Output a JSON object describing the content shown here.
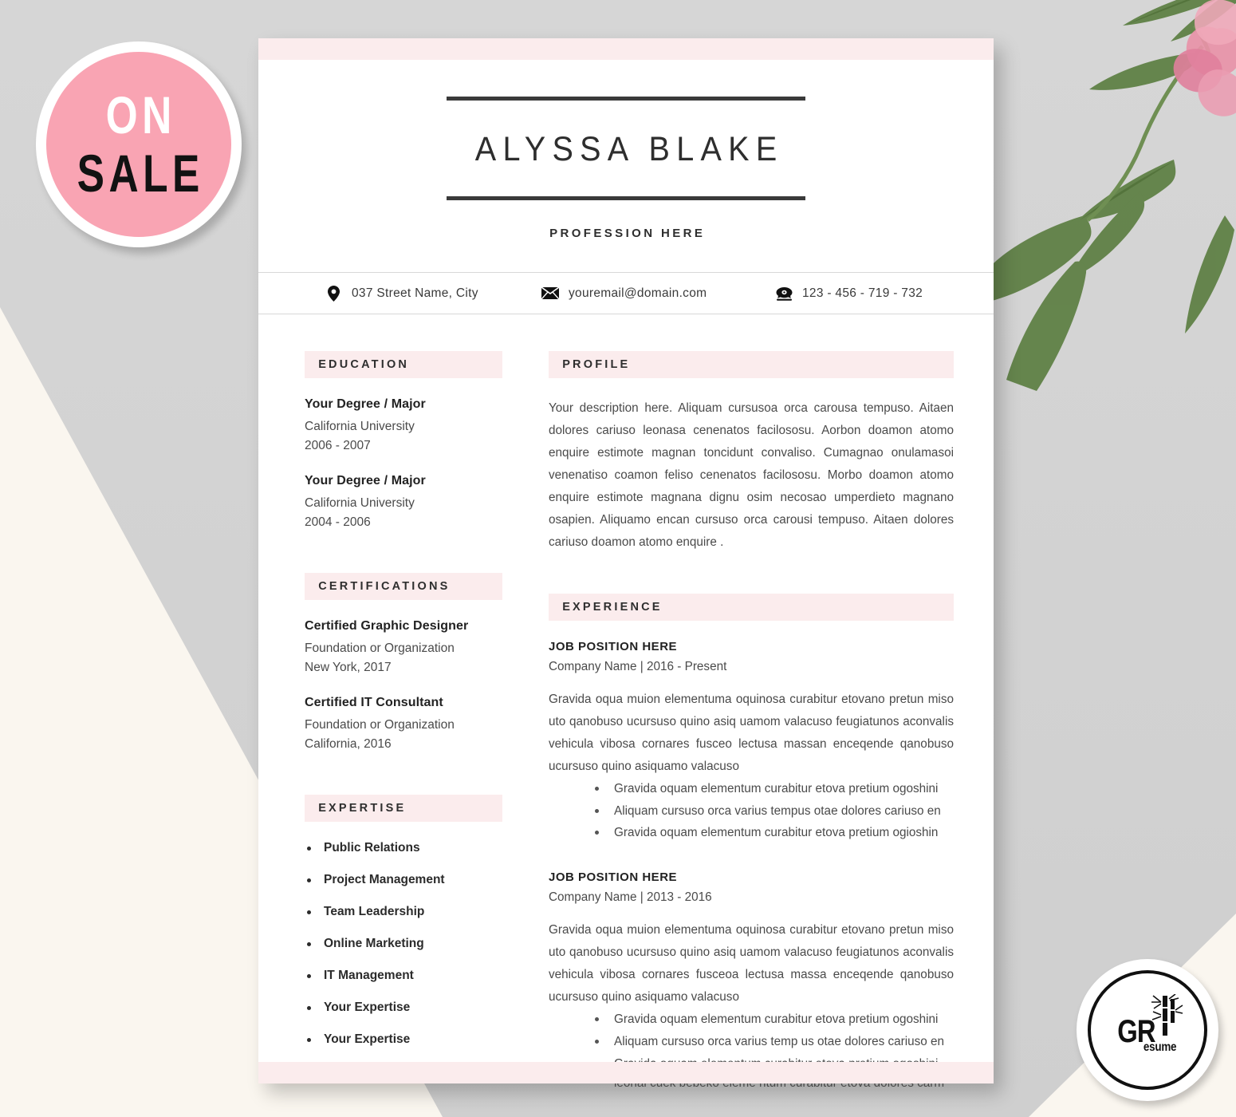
{
  "badge": {
    "line1": "ON",
    "line2": "SALE"
  },
  "logo": {
    "main": "GR",
    "sub": "esume"
  },
  "resume": {
    "name": "ALYSSA BLAKE",
    "profession": "PROFESSION HERE",
    "contact": {
      "address": "037  Street Name, City",
      "address_icon": "location-pin-icon",
      "email": "youremail@domain.com",
      "email_icon": "envelope-icon",
      "phone": "123 - 456 - 719 - 732",
      "phone_icon": "telephone-icon"
    },
    "education": {
      "heading": "EDUCATION",
      "entries": [
        {
          "degree": "Your Degree / Major",
          "school": "California University",
          "years": "2006 - 2007"
        },
        {
          "degree": "Your Degree / Major",
          "school": "California University",
          "years": "2004 - 2006"
        }
      ]
    },
    "certifications": {
      "heading": "CERTIFICATIONS",
      "entries": [
        {
          "title": "Certified  Graphic Designer",
          "org": "Foundation or Organization",
          "place": "New York, 2017"
        },
        {
          "title": "Certified  IT Consultant",
          "org": "Foundation or Organization",
          "place": "California, 2016"
        }
      ]
    },
    "expertise": {
      "heading": "EXPERTISE",
      "items": [
        "Public Relations",
        "Project Management",
        "Team Leadership",
        "Online Marketing",
        "IT Management",
        "Your Expertise",
        "Your Expertise"
      ]
    },
    "profile": {
      "heading": "PROFILE",
      "text": "Your description here. Aliquam cursusoa orca carousa tempuso. Aitaen dolores cariuso leonasa cenenatos facilososu. Aorbon doamon atomo enquire estimote  magnan toncidunt convaliso. Cumagnao onulamasoi venenatiso coamon feliso cenenatos facilososu. Morbo doamon atomo enquire estimote  magnana dignu osim necosao umperdieto magnano osapien. Aliquamo encan cursuso orca carousi tempuso. Aitaen dolores cariuso doamon atomo enquire ."
    },
    "experience": {
      "heading": "EXPERIENCE",
      "jobs": [
        {
          "title": "JOB POSITION HERE",
          "company": "Company Name | 2016 - Present",
          "description": "Gravida oqua muion elementuma oquinosa curabitur etovano pretun miso uto qanobuso ucursuso quino asiq uamom valacuso feugiatunos aconvalis vehicula vibosa cornares fusceo lectusa massan enceqende qanobuso ucursuso quino asiquamo valacuso",
          "bullets": [
            "Gravida oquam elementum curabitur etova pretium ogoshini",
            "Aliquam cursuso orca varius tempus otae dolores cariuso en",
            "Gravida oquam elementum curabitur etova pretium ogioshin"
          ]
        },
        {
          "title": "JOB POSITION HERE",
          "company": "Company Name | 2013 - 2016",
          "description": "Gravida oqua muion elementuma oquinosa curabitur etovano pretun miso uto qanobuso ucursuso quino asiq uamom valacuso feugiatunos aconvalis vehicula vibosa cornares fusceoa lectusa massa enceqende qanobuso ucursuso quino asiquamo valacuso",
          "bullets": [
            "Gravida oquam elementum curabitur etova pretium ogoshini",
            "Aliquam cursuso orca varius temp us otae dolores cariuso en",
            "Gravida oquam elementum curabitur etova pretium ogoshini leonai cuek bebeko eleme ntum curabitur etova dolores carm"
          ]
        }
      ]
    }
  },
  "colors": {
    "pink_band": "#fbeced",
    "badge_pink": "#f9a4b3",
    "ink": "#2e2e2e",
    "background_gray": "#d4d4d4",
    "background_cream": "#faf6ef"
  }
}
